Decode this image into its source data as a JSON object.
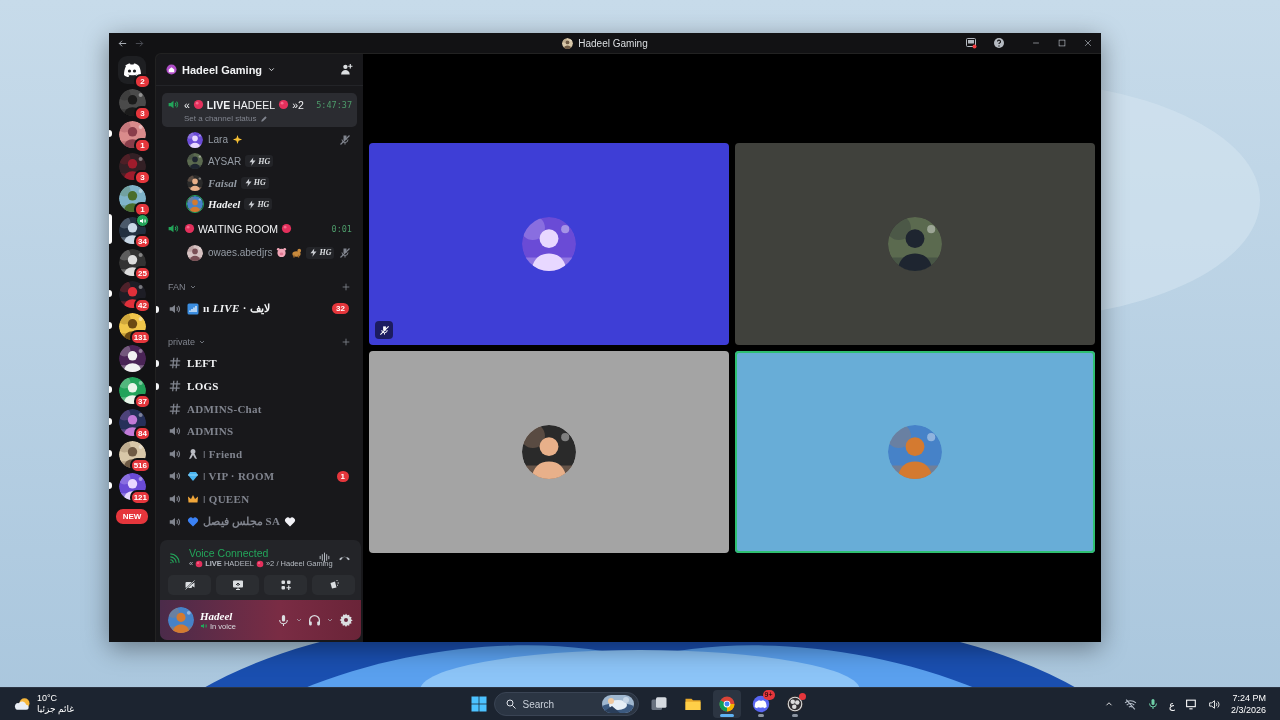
{
  "window": {
    "title": "Hadeel Gaming"
  },
  "servers": [
    {
      "kind": "home",
      "badge": "2",
      "selected": false,
      "unread": false,
      "voice": false
    },
    {
      "kind": "avatar",
      "badge": "3",
      "selected": false,
      "unread": false,
      "voice": false
    },
    {
      "kind": "avatar",
      "badge": "1",
      "selected": false,
      "unread": true,
      "voice": false
    },
    {
      "kind": "avatar",
      "badge": "3",
      "selected": false,
      "unread": false,
      "voice": false
    },
    {
      "kind": "avatar",
      "badge": "1",
      "selected": false,
      "unread": false,
      "voice": false
    },
    {
      "kind": "avatar",
      "badge": "34",
      "selected": true,
      "voice": true
    },
    {
      "kind": "avatar",
      "badge": "25",
      "selected": false,
      "unread": false,
      "voice": false
    },
    {
      "kind": "avatar",
      "badge": "42",
      "selected": false,
      "unread": true,
      "voice": false
    },
    {
      "kind": "avatar",
      "badge": "131",
      "selected": false,
      "unread": true,
      "voice": false
    },
    {
      "kind": "avatar",
      "selected": false,
      "unread": false,
      "voice": false
    },
    {
      "kind": "avatar",
      "badge": "37",
      "selected": false,
      "unread": true,
      "voice": false
    },
    {
      "kind": "avatar",
      "badge": "84",
      "selected": false,
      "unread": true,
      "voice": false
    },
    {
      "kind": "avatar",
      "badge": "516",
      "selected": false,
      "unread": true,
      "voice": false
    },
    {
      "kind": "avatar",
      "badge": "121",
      "selected": false,
      "unread": true,
      "voice": false
    }
  ],
  "new_pill": "NEW",
  "server_header": {
    "name": "Hadeel Gaming"
  },
  "voice_channels": [
    {
      "segments": [
        {
          "kind": "text",
          "text": "«"
        },
        {
          "kind": "dot"
        },
        {
          "kind": "text",
          "text": "**LIVE** HADEEL"
        },
        {
          "kind": "dot"
        },
        {
          "kind": "text",
          "text": "»2"
        }
      ],
      "timer": "5:47:37",
      "status": "Set a channel status",
      "selected": true,
      "members": [
        {
          "name": "Lara",
          "kind": "plain",
          "emoji": [
            {
              "kind": "sparkle"
            }
          ],
          "speaking": false,
          "muted": true
        },
        {
          "name": "AYSAR",
          "kind": "plain",
          "tag": "HG",
          "speaking": false,
          "muted": false
        },
        {
          "name": "Faisal",
          "kind": "fancy",
          "tag": "HG",
          "speaking": false,
          "muted": false
        },
        {
          "name": "Hadeel",
          "kind": "fancy",
          "tag": "HG",
          "speaking": true,
          "muted": false
        }
      ]
    },
    {
      "segments": [
        {
          "kind": "dot"
        },
        {
          "kind": "text",
          "text": "WAITING ROOM"
        },
        {
          "kind": "dot"
        }
      ],
      "timer": "0:01",
      "selected": false,
      "members": [
        {
          "name": "owaes.abedjrs",
          "kind": "plain",
          "emoji": [
            {
              "kind": "pig"
            },
            {
              "kind": "dog"
            }
          ],
          "tag": "HG",
          "speaking": false,
          "muted": true
        }
      ]
    }
  ],
  "categories": [
    {
      "name": "FAN",
      "channels": [
        {
          "kind": "voice",
          "segments": [
            {
              "kind": "bars"
            },
            {
              "kind": "text",
              "text": "ıı *LIVE* · لايف"
            }
          ],
          "unread": true,
          "badge": "32"
        }
      ]
    },
    {
      "name": "private",
      "channels": [
        {
          "kind": "text",
          "segments": [
            {
              "kind": "text",
              "text": "LEFT"
            }
          ],
          "unread": true
        },
        {
          "kind": "text",
          "segments": [
            {
              "kind": "text",
              "text": "LOGS"
            }
          ],
          "unread": true
        },
        {
          "kind": "text",
          "segments": [
            {
              "kind": "text",
              "text": "ADMINS-Chat"
            }
          ],
          "unread": false
        },
        {
          "kind": "voice",
          "segments": [
            {
              "kind": "text",
              "text": "ADMINS"
            }
          ],
          "unread": false
        },
        {
          "kind": "voice",
          "segments": [
            {
              "kind": "ribbon"
            },
            {
              "kind": "text",
              "text": "ǀ Friend"
            }
          ],
          "unread": false
        },
        {
          "kind": "voice",
          "segments": [
            {
              "kind": "diamond"
            },
            {
              "kind": "text",
              "text": "ǀ VIP · ROOM"
            }
          ],
          "unread": false,
          "badge": "1"
        },
        {
          "kind": "voice",
          "segments": [
            {
              "kind": "crown"
            },
            {
              "kind": "text",
              "text": "ǀ QUEEN"
            }
          ],
          "unread": false
        },
        {
          "kind": "voice",
          "segments": [
            {
              "kind": "heart",
              "color": "#3b82f6"
            },
            {
              "kind": "text",
              "text": "مجلس فيصل SA"
            },
            {
              "kind": "heart",
              "color": "#f2f2f7"
            }
          ],
          "unread": false
        }
      ]
    }
  ],
  "voice_panel": {
    "title": "Voice Connected",
    "segments": [
      {
        "kind": "text",
        "text": "«"
      },
      {
        "kind": "dot"
      },
      {
        "kind": "text",
        "text": "**LIVE** HADEEL"
      },
      {
        "kind": "dot"
      },
      {
        "kind": "text",
        "text": "»2 / Hadeel Gaming"
      }
    ]
  },
  "user_panel": {
    "name": "Hadeel",
    "status": "In voice"
  },
  "tiles": [
    {
      "color": "#3e3ed6",
      "speaking": false,
      "muted": true
    },
    {
      "color": "#40413c",
      "speaking": false,
      "muted": false
    },
    {
      "color": "#a4a4a4",
      "speaking": false,
      "muted": false
    },
    {
      "color": "#68add7",
      "speaking": true,
      "muted": false
    }
  ],
  "taskbar": {
    "weather": {
      "temp": "10°C",
      "condition": "غائم جزئيا"
    },
    "search": {
      "placeholder": "Search"
    },
    "apps": [
      {
        "kind": "taskview",
        "selected": false,
        "open": false
      },
      {
        "kind": "folder",
        "selected": false,
        "open": false
      },
      {
        "kind": "browser",
        "selected": true,
        "open": true
      },
      {
        "kind": "chat",
        "selected": false,
        "open": true,
        "badge": "9+"
      },
      {
        "kind": "recorder",
        "selected": false,
        "open": true,
        "alert": true
      }
    ],
    "language": "ع",
    "time": "7:24 PM",
    "date": "2/3/2026"
  }
}
